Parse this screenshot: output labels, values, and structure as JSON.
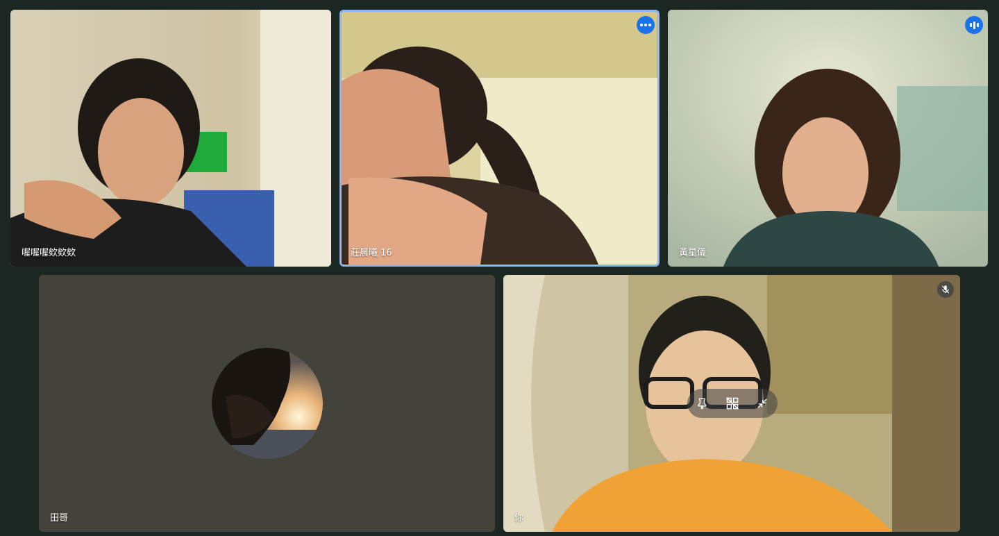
{
  "participants": [
    {
      "name": "喔喔喔欸欸欸"
    },
    {
      "name": "莊晨曦 16"
    },
    {
      "name": "黃星儀"
    },
    {
      "name": "田哥"
    },
    {
      "name": "你"
    }
  ],
  "colors": {
    "background": "#1b2722",
    "active_speaker_border": "#8ab4f8",
    "badge": "#1a73e8",
    "avatar_tile": "#44433b"
  },
  "icons": {
    "more_options": "more-options-icon",
    "speaking": "audio-level-icon",
    "muted": "mic-off-icon",
    "pin": "pin-icon",
    "remove_from_grid": "remove-from-grid-icon",
    "minimize": "minimize-icon"
  }
}
